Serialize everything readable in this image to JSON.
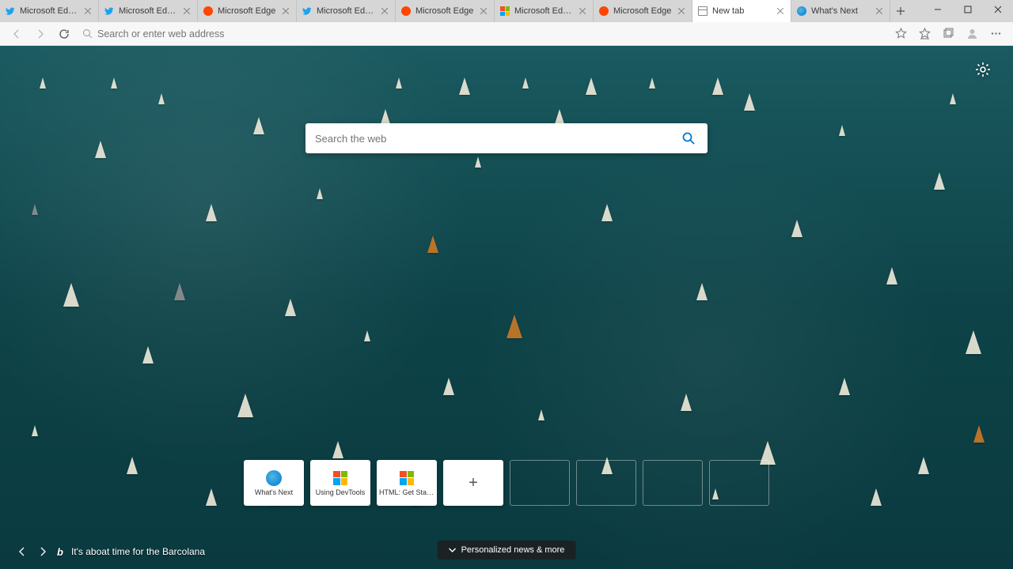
{
  "window": {
    "tabs": [
      {
        "title": "Microsoft Edge Dev (@",
        "icon": "twitter",
        "active": false
      },
      {
        "title": "Microsoft Edge Dev (@",
        "icon": "twitter",
        "active": false
      },
      {
        "title": "Microsoft Edge",
        "icon": "reddit",
        "active": false
      },
      {
        "title": "Microsoft Edge Dev (@",
        "icon": "twitter",
        "active": false
      },
      {
        "title": "Microsoft Edge",
        "icon": "reddit",
        "active": false
      },
      {
        "title": "Microsoft Edge Insider",
        "icon": "microsoft",
        "active": false
      },
      {
        "title": "Microsoft Edge",
        "icon": "reddit",
        "active": false
      },
      {
        "title": "New tab",
        "icon": "ntp",
        "active": true
      },
      {
        "title": "What's Next",
        "icon": "edge",
        "active": false
      }
    ]
  },
  "addressBar": {
    "placeholder": "Search or enter web address"
  },
  "newTabPage": {
    "searchPlaceholder": "Search the web",
    "quickLinks": [
      {
        "label": "What's Next",
        "icon": "edge",
        "kind": "filled"
      },
      {
        "label": "Using DevTools",
        "icon": "microsoft",
        "kind": "filled"
      },
      {
        "label": "HTML: Get Start...",
        "icon": "microsoft",
        "kind": "filled"
      },
      {
        "label": "",
        "icon": "add",
        "kind": "add"
      },
      {
        "label": "",
        "icon": "",
        "kind": "empty"
      },
      {
        "label": "",
        "icon": "",
        "kind": "empty"
      },
      {
        "label": "",
        "icon": "",
        "kind": "empty"
      },
      {
        "label": "",
        "icon": "",
        "kind": "empty"
      }
    ],
    "imageCaption": "It's aboat time for the Barcolana",
    "newsButton": "Personalized news & more"
  }
}
